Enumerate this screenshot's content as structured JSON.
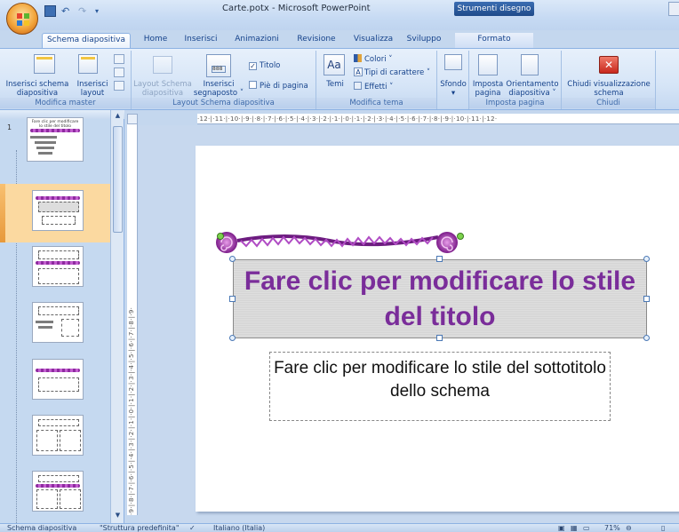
{
  "window": {
    "title": "Carte.potx - Microsoft PowerPoint",
    "context_tab_title": "Strumenti disegno"
  },
  "tabs": [
    {
      "label": "Schema diapositiva",
      "active": true
    },
    {
      "label": "Home"
    },
    {
      "label": "Inserisci"
    },
    {
      "label": "Animazioni"
    },
    {
      "label": "Revisione"
    },
    {
      "label": "Visualizza"
    },
    {
      "label": "Sviluppo"
    },
    {
      "label": "Formato",
      "context": true
    }
  ],
  "ribbon": {
    "groups": {
      "modifica_master": "Modifica master",
      "layout_schema": "Layout Schema diapositiva",
      "modifica_tema": "Modifica tema",
      "imposta_pagina": "Imposta pagina",
      "chiudi": "Chiudi"
    },
    "buttons": {
      "inserisci_schema_1": "Inserisci schema",
      "inserisci_schema_2": "diapositiva",
      "inserisci_layout_1": "Inserisci",
      "inserisci_layout_2": "layout",
      "layout_schema_1": "Layout Schema",
      "layout_schema_2": "diapositiva",
      "inserisci_segnaposto_1": "Inserisci",
      "inserisci_segnaposto_2": "segnaposto ˅",
      "titolo": "Titolo",
      "pie_di_pagina": "Piè di pagina",
      "temi": "Temi",
      "colori": "Colori ˅",
      "tipi_di_carattere": "Tipi di carattere ˅",
      "effetti": "Effetti ˅",
      "sfondo": "Sfondo",
      "imposta_pagina_1": "Imposta",
      "imposta_pagina_2": "pagina",
      "orientamento_1": "Orientamento",
      "orientamento_2": "diapositiva ˅",
      "chiudi_1": "Chiudi visualizzazione",
      "chiudi_2": "schema"
    },
    "titolo_checked": true,
    "pie_checked": false
  },
  "thumbnails": {
    "slide_number": "1",
    "master_caption": "Fare clic per modificare lo stile del titolo"
  },
  "rulers": {
    "horizontal": "·12·|·11·|·10·|·9·|·8·|·7·|·6·|·5·|·4·|·3·|·2·|·1·|·0·|·1·|·2·|·3·|·4·|·5·|·6·|·7·|·8·|·9·|·10·|·11·|·12·",
    "vertical": "·9·|·8·|·7·|·6·|·5·|·4·|·3·|·2·|·1·|·0·|·1·|·2·|·3·|·4·|·5·|·6·|·7·|·8·|·9·"
  },
  "slide": {
    "title": "Fare clic per modificare lo stile del titolo",
    "subtitle": "Fare clic per modificare lo stile del sottotitolo dello schema"
  },
  "colors": {
    "accent_purple": "#7a2d9a",
    "ribbon_text": "#15428b",
    "selection_orange": "#f2a43a"
  },
  "statusbar": {
    "view": "Schema diapositiva",
    "theme": "\"Struttura predefinita\"",
    "language": "Italiano (Italia)",
    "zoom": "71%"
  }
}
